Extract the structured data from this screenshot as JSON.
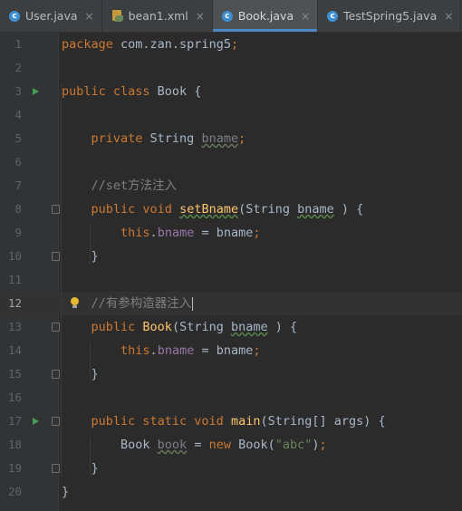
{
  "tabs": [
    {
      "label": "User.java",
      "icon": "java-class-icon",
      "active": false
    },
    {
      "label": "bean1.xml",
      "icon": "spring-xml-icon",
      "active": false
    },
    {
      "label": "Book.java",
      "icon": "java-class-icon",
      "active": true
    },
    {
      "label": "TestSpring5.java",
      "icon": "java-class-icon",
      "active": false
    }
  ],
  "editor": {
    "current_line": 12,
    "lines": [
      {
        "n": "1",
        "tokens": [
          [
            "kw",
            "package "
          ],
          [
            "",
            "com.zan.spring5"
          ],
          [
            "kw",
            ";"
          ]
        ]
      },
      {
        "n": "2",
        "tokens": []
      },
      {
        "n": "3",
        "run": true,
        "tokens": [
          [
            "kw",
            "public class "
          ],
          [
            "",
            "Book {"
          ]
        ]
      },
      {
        "n": "4",
        "tokens": []
      },
      {
        "n": "5",
        "tokens": [
          [
            "",
            "    "
          ],
          [
            "kw",
            "private "
          ],
          [
            "",
            "String "
          ],
          [
            "unused",
            "bname"
          ],
          [
            "kw",
            ";"
          ]
        ]
      },
      {
        "n": "6",
        "tokens": []
      },
      {
        "n": "7",
        "tokens": [
          [
            "",
            "    "
          ],
          [
            "cmt",
            "//set方法注入"
          ]
        ]
      },
      {
        "n": "8",
        "fold": true,
        "tokens": [
          [
            "",
            "    "
          ],
          [
            "kw",
            "public void "
          ],
          [
            "fn typo",
            "setBname"
          ],
          [
            "",
            "(String "
          ],
          [
            "typo",
            "bname"
          ],
          [
            "",
            " ) {"
          ]
        ]
      },
      {
        "n": "9",
        "tokens": [
          [
            "",
            "        "
          ],
          [
            "kw",
            "this"
          ],
          [
            "",
            "."
          ],
          [
            "fld",
            "bname"
          ],
          [
            "",
            " = bname"
          ],
          [
            "kw",
            ";"
          ]
        ]
      },
      {
        "n": "10",
        "fold": true,
        "tokens": [
          [
            "",
            "    }"
          ]
        ]
      },
      {
        "n": "11",
        "tokens": []
      },
      {
        "n": "12",
        "bulb": true,
        "caret": true,
        "tokens": [
          [
            "",
            "    "
          ],
          [
            "cmt",
            "//有参构造器注入"
          ]
        ]
      },
      {
        "n": "13",
        "fold": true,
        "tokens": [
          [
            "",
            "    "
          ],
          [
            "kw",
            "public "
          ],
          [
            "fn",
            "Book"
          ],
          [
            "",
            "(String "
          ],
          [
            "typo",
            "bname"
          ],
          [
            "",
            " ) {"
          ]
        ]
      },
      {
        "n": "14",
        "tokens": [
          [
            "",
            "        "
          ],
          [
            "kw",
            "this"
          ],
          [
            "",
            "."
          ],
          [
            "fld",
            "bname"
          ],
          [
            "",
            " = bname"
          ],
          [
            "kw",
            ";"
          ]
        ]
      },
      {
        "n": "15",
        "fold": true,
        "tokens": [
          [
            "",
            "    }"
          ]
        ]
      },
      {
        "n": "16",
        "tokens": []
      },
      {
        "n": "17",
        "run": true,
        "fold": true,
        "tokens": [
          [
            "",
            "    "
          ],
          [
            "kw",
            "public static void "
          ],
          [
            "fn",
            "main"
          ],
          [
            "",
            "(String[] args) {"
          ]
        ]
      },
      {
        "n": "18",
        "tokens": [
          [
            "",
            "        Book "
          ],
          [
            "unused",
            "book"
          ],
          [
            "",
            " = "
          ],
          [
            "kw",
            "new "
          ],
          [
            "",
            "Book("
          ],
          [
            "str",
            "\"abc\""
          ],
          [
            "",
            ")"
          ],
          [
            "kw",
            ";"
          ]
        ]
      },
      {
        "n": "19",
        "fold": true,
        "tokens": [
          [
            "",
            "    }"
          ]
        ]
      },
      {
        "n": "20",
        "tokens": [
          [
            "",
            "}"
          ]
        ]
      }
    ]
  }
}
